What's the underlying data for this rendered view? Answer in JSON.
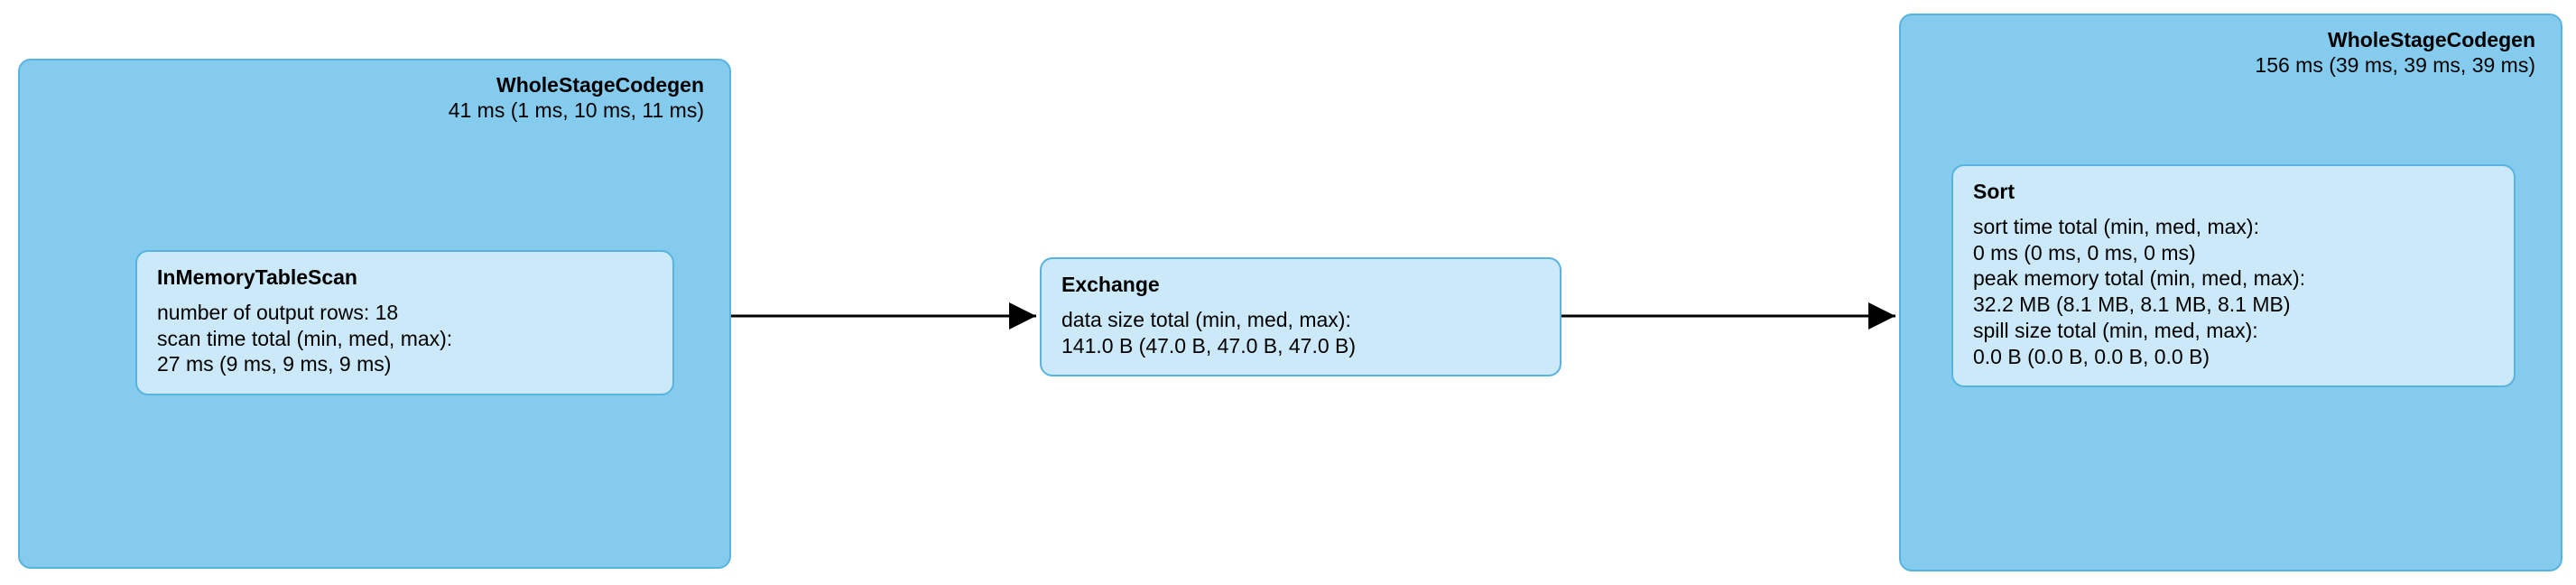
{
  "stage_left": {
    "title": "WholeStageCodegen",
    "subtitle": "41 ms (1 ms, 10 ms, 11 ms)",
    "inner": {
      "title": "InMemoryTableScan",
      "line1": "number of output rows: 18",
      "line2": "scan time total (min, med, max):",
      "line3": "27 ms (9 ms, 9 ms, 9 ms)"
    }
  },
  "exchange": {
    "title": "Exchange",
    "line1": "data size total (min, med, max):",
    "line2": "141.0 B (47.0 B, 47.0 B, 47.0 B)"
  },
  "stage_right": {
    "title": "WholeStageCodegen",
    "subtitle": "156 ms (39 ms, 39 ms, 39 ms)",
    "inner": {
      "title": "Sort",
      "line1": "sort time total (min, med, max):",
      "line2": "0 ms (0 ms, 0 ms, 0 ms)",
      "line3": "peak memory total (min, med, max):",
      "line4": "32.2 MB (8.1 MB, 8.1 MB, 8.1 MB)",
      "line5": "spill size total (min, med, max):",
      "line6": "0.0 B (0.0 B, 0.0 B, 0.0 B)"
    }
  }
}
